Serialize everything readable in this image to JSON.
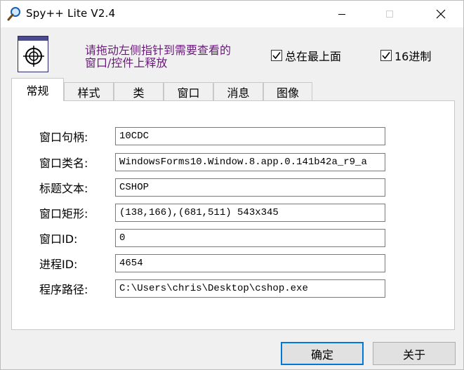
{
  "window": {
    "title": "Spy++ Lite V2.4",
    "app_icon": "magnifier-icon",
    "controls": {
      "minimize_icon": "minimize-icon",
      "maximize_icon": "maximize-icon",
      "close_icon": "close-icon"
    }
  },
  "toolbar": {
    "target_icon": "crosshair-target-icon",
    "hint": "请拖动左侧指针到需要查看的窗口/控件上释放",
    "always_on_top": {
      "label": "总在最上面",
      "checked": true
    },
    "hex": {
      "label": "16进制",
      "checked": true
    }
  },
  "tabs": [
    {
      "label": "常规",
      "active": true
    },
    {
      "label": "样式",
      "active": false
    },
    {
      "label": "类",
      "active": false
    },
    {
      "label": "窗口",
      "active": false
    },
    {
      "label": "消息",
      "active": false
    },
    {
      "label": "图像",
      "active": false
    }
  ],
  "fields": [
    {
      "label": "窗口句柄:",
      "value": "10CDC"
    },
    {
      "label": "窗口类名:",
      "value": "WindowsForms10.Window.8.app.0.141b42a_r9_a"
    },
    {
      "label": "标题文本:",
      "value": "CSHOP"
    },
    {
      "label": "窗口矩形:",
      "value": "(138,166),(681,511)  543x345"
    },
    {
      "label": "窗口ID:",
      "value": "0"
    },
    {
      "label": "进程ID:",
      "value": "4654"
    },
    {
      "label": "程序路径:",
      "value": "C:\\Users\\chris\\Desktop\\cshop.exe"
    }
  ],
  "buttons": {
    "ok": "确定",
    "about": "关于"
  },
  "colors": {
    "hint_text": "#6a1a7a",
    "default_button_border": "#0078d7"
  }
}
